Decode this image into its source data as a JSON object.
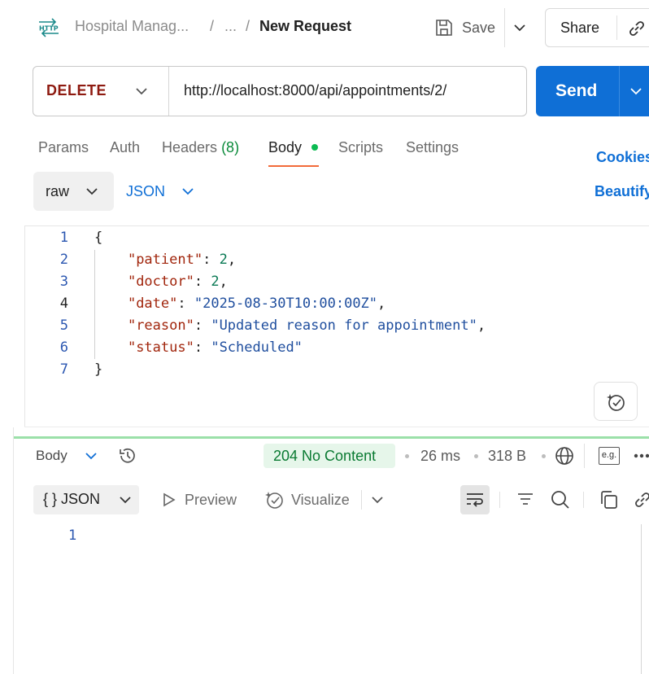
{
  "header": {
    "icon": "http-icon",
    "breadcrumb_collection": "Hospital Manag...",
    "breadcrumb_sep1": "/",
    "breadcrumb_ellipsis": "...",
    "breadcrumb_sep2": "/",
    "request_title": "New Request",
    "save_label": "Save",
    "share_label": "Share"
  },
  "request": {
    "method": "DELETE",
    "url": "http://localhost:8000/api/appointments/2/",
    "send_label": "Send"
  },
  "tabs": {
    "params": "Params",
    "auth": "Auth",
    "headers": "Headers",
    "headers_count": "(8)",
    "body": "Body",
    "scripts": "Scripts",
    "settings": "Settings",
    "cookies": "Cookies",
    "beautify": "Beautify"
  },
  "body_type": {
    "mode": "raw",
    "language": "JSON"
  },
  "editor": {
    "line_numbers": [
      "1",
      "2",
      "3",
      "4",
      "5",
      "6",
      "7"
    ],
    "lines": {
      "l1": "{",
      "k_patient": "\"patient\"",
      "v_patient": "2",
      "k_doctor": "\"doctor\"",
      "v_doctor": "2",
      "k_date": "\"date\"",
      "v_date": "\"2025-08-30T10:00:00Z\"",
      "k_reason": "\"reason\"",
      "v_reason": "\"Updated reason for appointment\"",
      "k_status": "\"status\"",
      "v_status": "\"Scheduled\"",
      "l7": "}",
      "colon": ": ",
      "comma": ","
    }
  },
  "response": {
    "section_label": "Body",
    "status": "204 No Content",
    "time": "26 ms",
    "size": "318 B",
    "format": "JSON",
    "format_glyph": "{ }",
    "preview_label": "Preview",
    "visualize_label": "Visualize",
    "line_number": "1",
    "example_badge": "e.g."
  },
  "colors": {
    "accent": "#0f6fd6",
    "method_delete": "#8e1a10",
    "status_ok": "#0a7a32",
    "tab_underline": "#f26b3a"
  }
}
